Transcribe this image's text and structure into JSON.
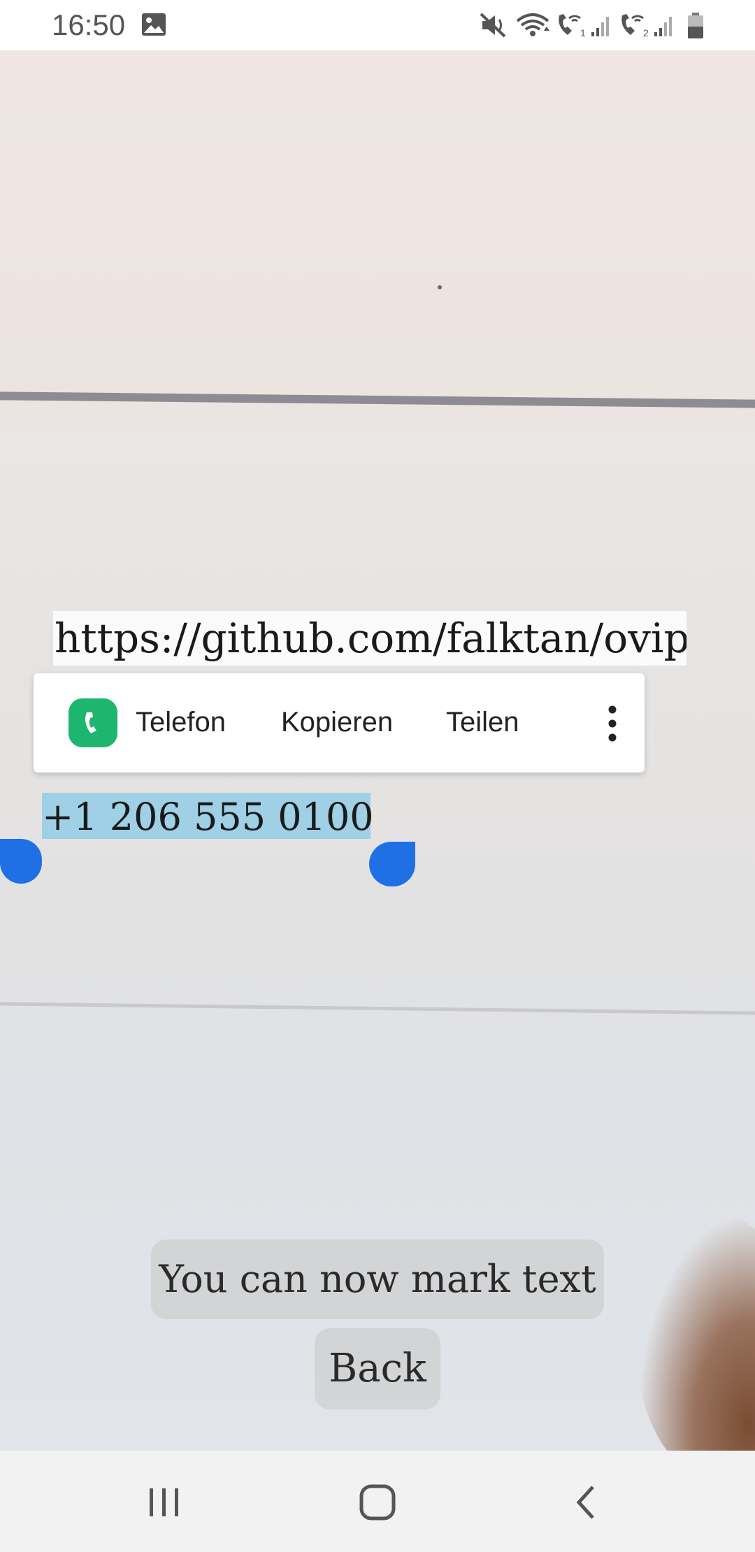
{
  "status_bar": {
    "time": "16:50",
    "left_icons": [
      "gallery-icon"
    ],
    "right_icons": [
      "mute-icon",
      "wifi-icon",
      "wifi-call-sim1-icon",
      "signal-sim1-icon",
      "wifi-call-sim2-icon",
      "signal-sim2-icon",
      "battery-icon"
    ]
  },
  "camera_view": {
    "recognized_url": "https://github.com/falktan/ovip",
    "recognized_phone": "+1 206 555 0100"
  },
  "context_menu": {
    "app_icon": "phone-app-icon",
    "items": [
      {
        "label": "Telefon"
      },
      {
        "label": "Kopieren"
      },
      {
        "label": "Teilen"
      }
    ],
    "more_icon": "more-vert-icon"
  },
  "toast": {
    "message": "You can now mark text"
  },
  "back_button": {
    "label": "Back"
  },
  "nav_bar": {
    "buttons": [
      "recent-apps-icon",
      "home-icon",
      "back-icon"
    ]
  },
  "colors": {
    "selection_handle": "#1f6fe5",
    "selection_highlight": "#81c8e8",
    "phone_app": "#1db56f"
  }
}
